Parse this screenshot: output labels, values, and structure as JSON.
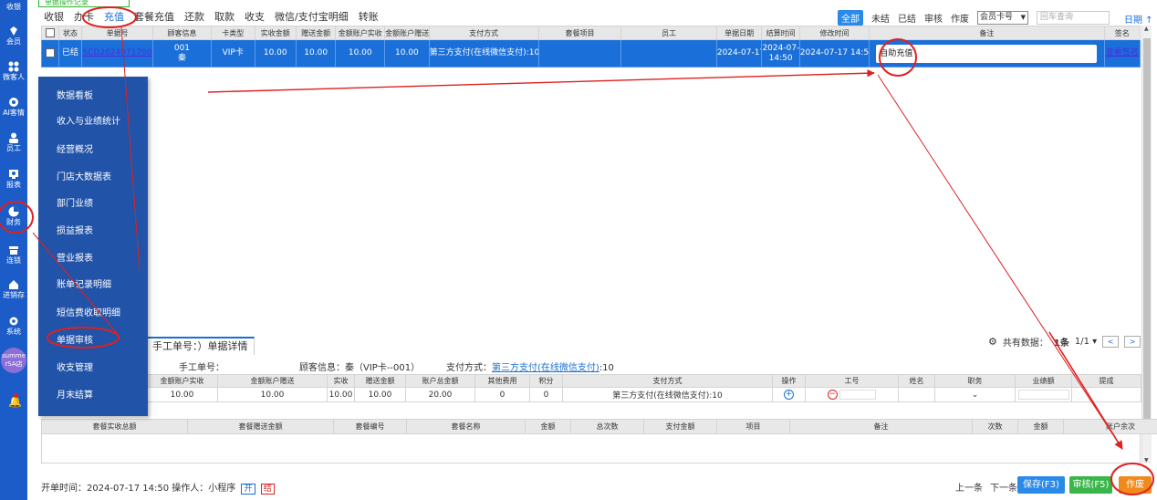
{
  "topstrip": "单据操作记录",
  "sidebar": {
    "top_label": "收银",
    "items": [
      {
        "label": "会员"
      },
      {
        "label": "微客人"
      },
      {
        "label": "AI客情"
      },
      {
        "label": "员工"
      },
      {
        "label": "报表"
      },
      {
        "label": "财务"
      },
      {
        "label": "连锁"
      },
      {
        "label": "进销存"
      },
      {
        "label": "系统"
      }
    ],
    "avatar": "summe\nrSA店"
  },
  "tabs": [
    "收银",
    "办卡",
    "充值",
    "套餐充值",
    "还款",
    "取款",
    "收支",
    "微信/支付宝明细",
    "转账"
  ],
  "active_tab": "充值",
  "filters": {
    "status": [
      "全部",
      "未结",
      "已结",
      "审核",
      "作废"
    ],
    "select_value": "会员卡号",
    "search_placeholder": "回车查询",
    "date_label": "日期"
  },
  "main_table": {
    "headers": [
      "",
      "状态",
      "单据号",
      "顾客信息",
      "卡类型",
      "实收金额",
      "赠送金额",
      "金额账户实收",
      "金额账户赠送",
      "支付方式",
      "套餐项目",
      "员工",
      "单据日期",
      "结算时间",
      "修改时间",
      "备注",
      "签名"
    ],
    "row": {
      "status": "已结",
      "order_no": "SCD20240717000002",
      "customer_id": "001",
      "customer_name": "秦",
      "card_type": "VIP卡",
      "paid": "10.00",
      "gift": "10.00",
      "acct_paid": "10.00",
      "acct_gift": "10.00",
      "pay_method": "第三方支付(在线微信支付):10.00",
      "package": "",
      "staff": "",
      "doc_date": "2024-07-17",
      "settle_date": "2024-07-17",
      "settle_time": "14:50",
      "modify_time": "2024-07-17 14:50",
      "note": "自助充值",
      "signature": "查看签名"
    }
  },
  "menu": [
    "数据看板",
    "收入与业绩统计",
    "经营概况",
    "门店大数据表",
    "部门业绩",
    "损益报表",
    "营业报表",
    "账单记录明细",
    "短信费收取明细",
    "单据审核",
    "收支管理",
    "月末结算"
  ],
  "detail": {
    "tab_label": "手工单号：）单据详情",
    "total_prefix": "共有数据：",
    "total_count": "1条",
    "page": "1/1",
    "manual_no_label": "手工单号：",
    "customer_label": "顾客信息：秦（VIP卡--001）",
    "pay_label": "支付方式：",
    "pay_value": "第三方支付(在线微信支付)",
    "pay_amount": ":10",
    "headers": [
      "金额账户实收",
      "金额账户赠送",
      "实收",
      "赠送金额",
      "账户总金额",
      "其他费用",
      "积分",
      "支付方式",
      "操作",
      "工号",
      "姓名",
      "职务",
      "业绩额",
      "提成"
    ],
    "values": [
      "10.00",
      "10.00",
      "10.00",
      "10.00",
      "20.00",
      "0",
      "0",
      "第三方支付(在线微信支付):10",
      "",
      "",
      "",
      "",
      "",
      ""
    ]
  },
  "package_table": {
    "headers": [
      "套餐实收总额",
      "套餐赠送金额",
      "套餐编号",
      "套餐名称",
      "金额",
      "总次数",
      "支付金额",
      "项目",
      "备注",
      "次数",
      "金额",
      "账户余次"
    ]
  },
  "footer": {
    "info": "开单时间：2024-07-17 14:50 操作人：小程序",
    "tag_open": "开",
    "tag_settle": "结",
    "prev": "上一条",
    "next": "下一条",
    "save": "保存(F3)",
    "audit": "审核(F5)",
    "void": "作废"
  },
  "colors": {
    "sidebar": "#1b5cc8",
    "selected_row": "#1b6fd8",
    "menu": "#2153a8",
    "annotation": "#e02020"
  }
}
